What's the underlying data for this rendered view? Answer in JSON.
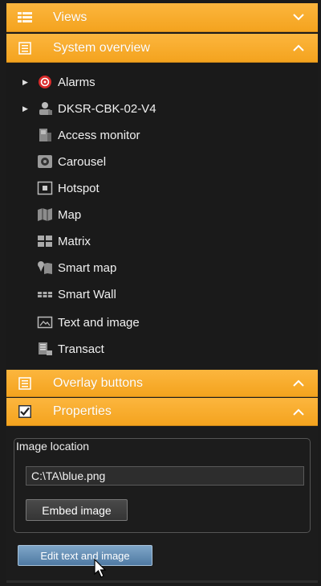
{
  "panels": {
    "views": {
      "title": "Views",
      "chevron": "down"
    },
    "system_overview": {
      "title": "System overview",
      "chevron": "up"
    },
    "overlay_buttons": {
      "title": "Overlay buttons",
      "chevron": "up"
    },
    "properties": {
      "title": "Properties",
      "chevron": "up",
      "checked": true
    }
  },
  "tree": {
    "items": [
      {
        "label": "Alarms",
        "icon": "alarm-icon",
        "expandable": true
      },
      {
        "label": "DKSR-CBK-02-V4",
        "icon": "server-icon",
        "expandable": true
      },
      {
        "label": "Access monitor",
        "icon": "access-monitor-icon",
        "expandable": false
      },
      {
        "label": "Carousel",
        "icon": "carousel-icon",
        "expandable": false
      },
      {
        "label": "Hotspot",
        "icon": "hotspot-icon",
        "expandable": false
      },
      {
        "label": "Map",
        "icon": "map-icon",
        "expandable": false
      },
      {
        "label": "Matrix",
        "icon": "matrix-icon",
        "expandable": false
      },
      {
        "label": "Smart map",
        "icon": "smart-map-icon",
        "expandable": false
      },
      {
        "label": "Smart Wall",
        "icon": "smart-wall-icon",
        "expandable": false
      },
      {
        "label": "Text and image",
        "icon": "text-image-icon",
        "expandable": false
      },
      {
        "label": "Transact",
        "icon": "transact-icon",
        "expandable": false
      }
    ]
  },
  "properties": {
    "image_location_label": "Image location",
    "image_location_value": "C:\\TA\\blue.png",
    "embed_button": "Embed image",
    "edit_button": "Edit text and image"
  },
  "colors": {
    "header_orange": "#f7a823",
    "background": "#1b1b1b",
    "edit_button_blue": "#5f89b0"
  }
}
